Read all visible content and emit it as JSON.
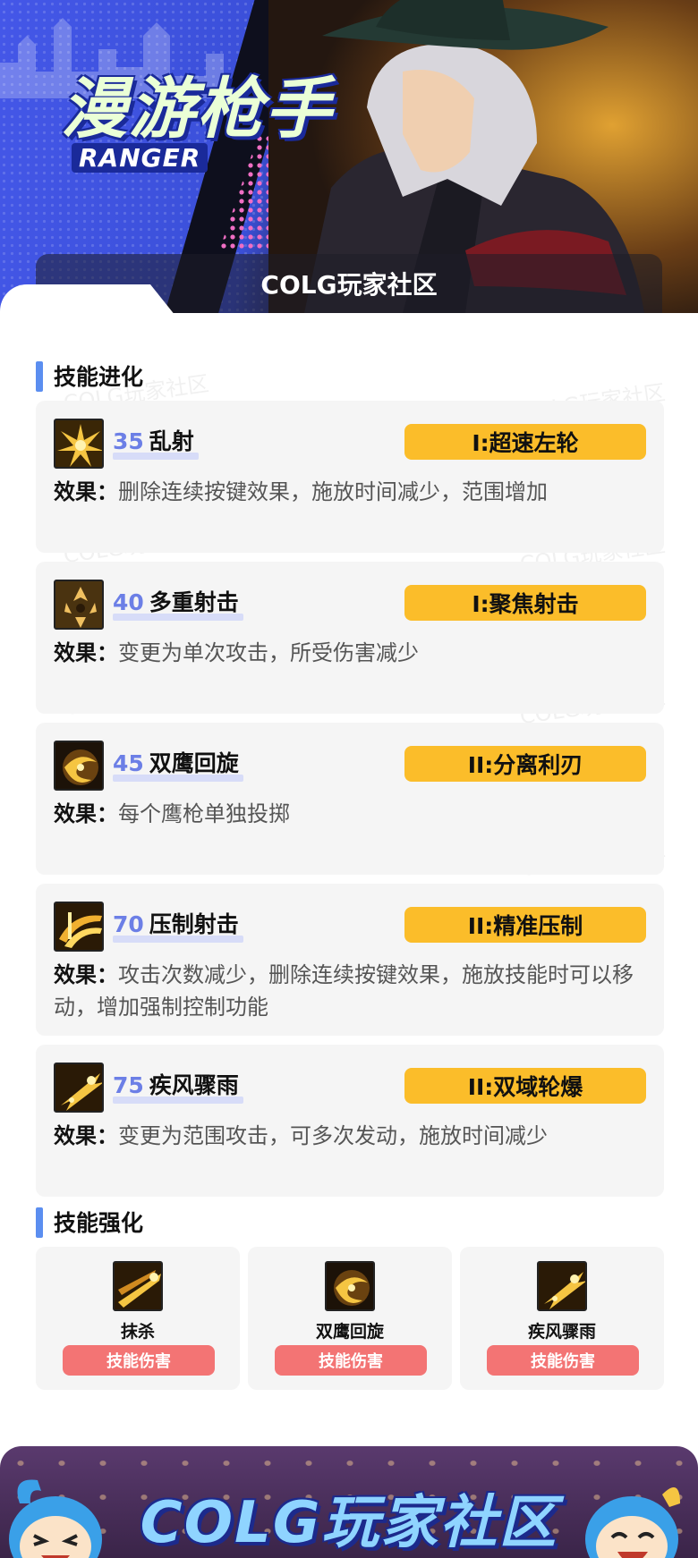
{
  "banner": {
    "title": "漫游枪手",
    "subtitle": "RANGER",
    "community": "COLG玩家社区"
  },
  "watermark": "COLG玩家社区",
  "sections": {
    "evolution_title": "技能进化",
    "enhancement_title": "技能强化"
  },
  "evolution": [
    {
      "level": "35",
      "name": "乱射",
      "tag": "I:超速左轮",
      "effect_label": "效果：",
      "effect": "删除连续按键效果，施放时间减少，范围增加",
      "icon": "spray-fire-icon"
    },
    {
      "level": "40",
      "name": "多重射击",
      "tag": "I:聚焦射击",
      "effect_label": "效果：",
      "effect": "变更为单次攻击，所受伤害减少",
      "icon": "multi-shot-icon"
    },
    {
      "level": "45",
      "name": "双鹰回旋",
      "tag": "II:分离利刃",
      "effect_label": "效果：",
      "effect": "每个鹰枪单独投掷",
      "icon": "twin-eagle-icon"
    },
    {
      "level": "70",
      "name": "压制射击",
      "tag": "II:精准压制",
      "effect_label": "效果：",
      "effect": "攻击次数减少，删除连续按键效果，施放技能时可以移动，增加强制控制功能",
      "icon": "suppress-fire-icon"
    },
    {
      "level": "75",
      "name": "疾风骤雨",
      "tag": "II:双域轮爆",
      "effect_label": "效果：",
      "effect": "变更为范围攻击，可多次发动，施放时间减少",
      "icon": "storm-shot-icon"
    }
  ],
  "enhancements": [
    {
      "name": "抹杀",
      "button": "技能伤害",
      "icon": "obliterate-icon"
    },
    {
      "name": "双鹰回旋",
      "button": "技能伤害",
      "icon": "twin-eagle-icon"
    },
    {
      "name": "疾风骤雨",
      "button": "技能伤害",
      "icon": "storm-shot-icon"
    }
  ],
  "footer": {
    "title": "COLG玩家社区"
  },
  "colors": {
    "accent_blue": "#5b8ef0",
    "level_blue": "#6c7fe6",
    "tag_yellow": "#fbbd2a",
    "button_red": "#f37474",
    "card_bg": "#f5f5f5"
  }
}
